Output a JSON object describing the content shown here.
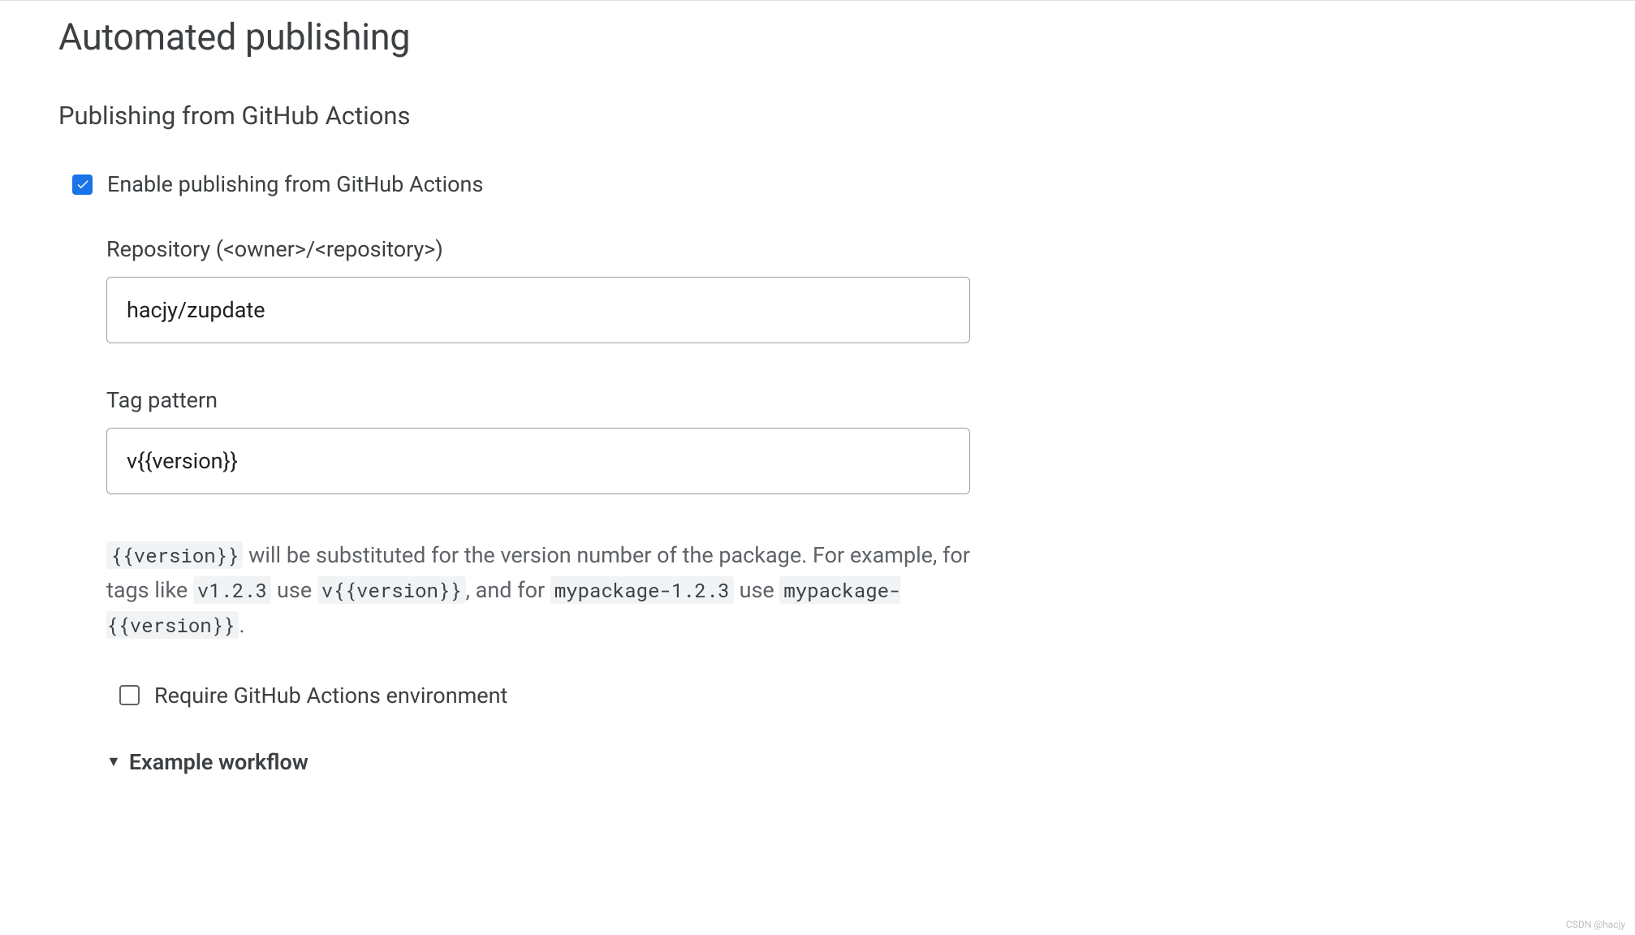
{
  "page": {
    "title": "Automated publishing",
    "section_title": "Publishing from GitHub Actions"
  },
  "enable_checkbox": {
    "label": "Enable publishing from GitHub Actions",
    "checked": true
  },
  "repository_field": {
    "label": "Repository (<owner>/<repository>)",
    "value": "hacjy/zupdate"
  },
  "tag_pattern_field": {
    "label": "Tag pattern",
    "value": "v{{version}}"
  },
  "help_text": {
    "code1": "{{version}}",
    "text1": " will be substituted for the version number of the package. For example, for tags like ",
    "code2": "v1.2.3",
    "text2": " use ",
    "code3": "v{{version}}",
    "text3": ", and for ",
    "code4": "mypackage-1.2.3",
    "text4": " use ",
    "code5": "mypackage-{{version}}",
    "text5": "."
  },
  "require_checkbox": {
    "label": "Require GitHub Actions environment",
    "checked": false
  },
  "expand": {
    "label": "Example workflow"
  },
  "watermark": "CSDN @hacjy"
}
